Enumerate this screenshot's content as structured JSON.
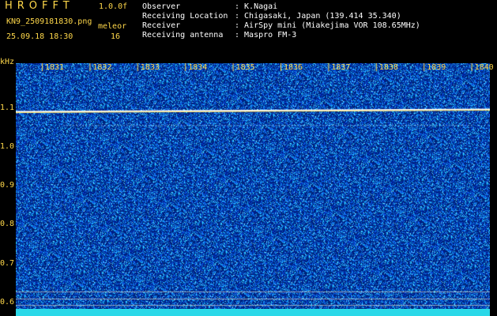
{
  "app": {
    "title": "HROFFT",
    "version": "1.0.0f",
    "file_name": "KN9_2509181830.png",
    "date_time": "25.09.18 18:30",
    "meleor_label": "meleor",
    "meleor_count": "16"
  },
  "info": [
    {
      "key": "Observer",
      "value": ": K.Nagai"
    },
    {
      "key": "Receiving Location",
      "value": ": Chigasaki, Japan (139.414 35.340)"
    },
    {
      "key": "Receiver",
      "value": ": AirSpy mini (Miakejima VOR 108.65MHz)"
    },
    {
      "key": "Receiving antenna",
      "value": ": Maspro FM-3"
    }
  ],
  "spectrogram": {
    "y_unit": "kHz",
    "x_ticks": [
      "1831",
      "1832",
      "1833",
      "1834",
      "1835",
      "1836",
      "1837",
      "1838",
      "1839",
      "1840"
    ],
    "y_ticks": [
      "1.1",
      "1.0",
      "0.9",
      "0.8",
      "0.7",
      "0.6"
    ],
    "y_values": [
      1.1,
      1.0,
      0.9,
      0.8,
      0.7,
      0.6
    ],
    "y_range": [
      0.565,
      1.215
    ],
    "carrier_khz": 1.09,
    "faint_line_khz": 1.055,
    "colors": {
      "background": "#00106e",
      "noise": "#2a7bff",
      "carrier": "#ffe060",
      "ticks": "#ffd84a"
    }
  }
}
